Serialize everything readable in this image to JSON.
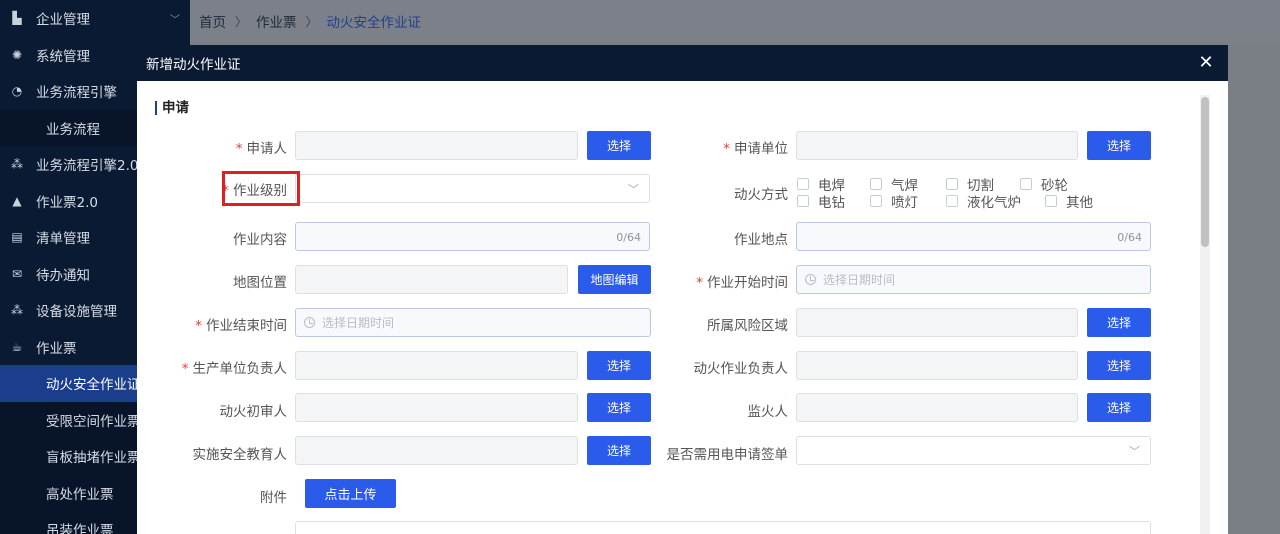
{
  "sidebar": {
    "items": [
      {
        "label": "企业管理",
        "icon": "building-icon"
      },
      {
        "label": "系统管理",
        "icon": "gear-icon"
      },
      {
        "label": "业务流程引擎",
        "icon": "chart-icon"
      },
      {
        "label": "业务流程",
        "sub": true
      },
      {
        "label": "业务流程引擎2.0",
        "icon": "sitemap-icon"
      },
      {
        "label": "作业票2.0",
        "icon": "cone-icon"
      },
      {
        "label": "清单管理",
        "icon": "list-icon"
      },
      {
        "label": "待办通知",
        "icon": "mail-icon"
      },
      {
        "label": "设备设施管理",
        "icon": "sitemap-icon"
      },
      {
        "label": "作业票",
        "icon": "cup-icon"
      },
      {
        "label": "动火安全作业证",
        "sub": true,
        "active": true
      },
      {
        "label": "受限空间作业票",
        "sub": true
      },
      {
        "label": "盲板抽堵作业票",
        "sub": true
      },
      {
        "label": "高处作业票",
        "sub": true
      },
      {
        "label": "吊装作业票",
        "sub": true
      }
    ]
  },
  "breadcrumb": {
    "home": "首页",
    "level1": "作业票",
    "current": "动火安全作业证"
  },
  "modal": {
    "title": "新增动火作业证",
    "close_symbol": "✕",
    "section": "申请",
    "fields": {
      "applicant": "申请人",
      "apply_unit": "申请单位",
      "work_level": "作业级别",
      "fire_method": "动火方式",
      "work_content": "作业内容",
      "work_location": "作业地点",
      "map_position": "地图位置",
      "start_time": "作业开始时间",
      "end_time": "作业结束时间",
      "risk_area": "所属风险区域",
      "prod_leader": "生产单位负责人",
      "fire_leader": "动火作业负责人",
      "first_reviewer": "动火初审人",
      "fire_watcher": "监火人",
      "safety_educator": "实施安全教育人",
      "need_electric": "是否需用电申请签单",
      "attachment": "附件"
    },
    "counter": "0/64",
    "date_placeholder": "选择日期时间",
    "buttons": {
      "select": "选择",
      "map_edit": "地图编辑",
      "upload": "点击上传"
    },
    "fire_methods": [
      "电焊",
      "气焊",
      "切割",
      "砂轮",
      "电钻",
      "喷灯",
      "液化气炉",
      "其他"
    ]
  }
}
